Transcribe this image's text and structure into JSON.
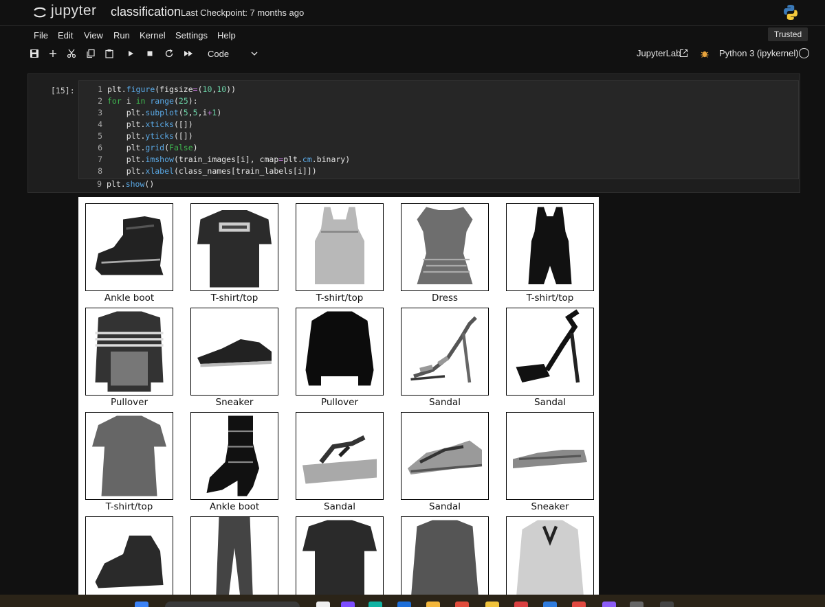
{
  "header": {
    "brand": "jupyter",
    "notebook_name": "classification",
    "checkpoint": "Last Checkpoint: 7 months ago",
    "icons": [
      "jupyter-logo-icon",
      "python-logo-icon"
    ]
  },
  "menu": {
    "items": [
      "File",
      "Edit",
      "View",
      "Run",
      "Kernel",
      "Settings",
      "Help"
    ],
    "trusted": "Trusted"
  },
  "toolbar": {
    "buttons": [
      "save-icon",
      "add-cell-icon",
      "cut-icon",
      "copy-icon",
      "paste-icon",
      "run-icon",
      "stop-icon",
      "restart-icon",
      "fast-forward-icon"
    ],
    "cell_type": "Code",
    "jupyterlab_link": "JupyterLab",
    "kernel_name": "Python 3 (ipykernel)"
  },
  "cell": {
    "prompt": "[15]:",
    "line_numbers": [
      "1",
      "2",
      "3",
      "4",
      "5",
      "6",
      "7",
      "8",
      "9"
    ]
  },
  "output": {
    "labels": [
      "Ankle boot",
      "T-shirt/top",
      "T-shirt/top",
      "Dress",
      "T-shirt/top",
      "Pullover",
      "Sneaker",
      "Pullover",
      "Sandal",
      "Sandal",
      "T-shirt/top",
      "Ankle boot",
      "Sandal",
      "Sandal",
      "Sneaker"
    ]
  },
  "colors": {
    "background": "#111111",
    "cell_bg": "#1e1e1e",
    "editor_bg": "#262626",
    "keyword": "#3fb950",
    "function": "#5aa9e6",
    "number": "#6cd4a8"
  }
}
